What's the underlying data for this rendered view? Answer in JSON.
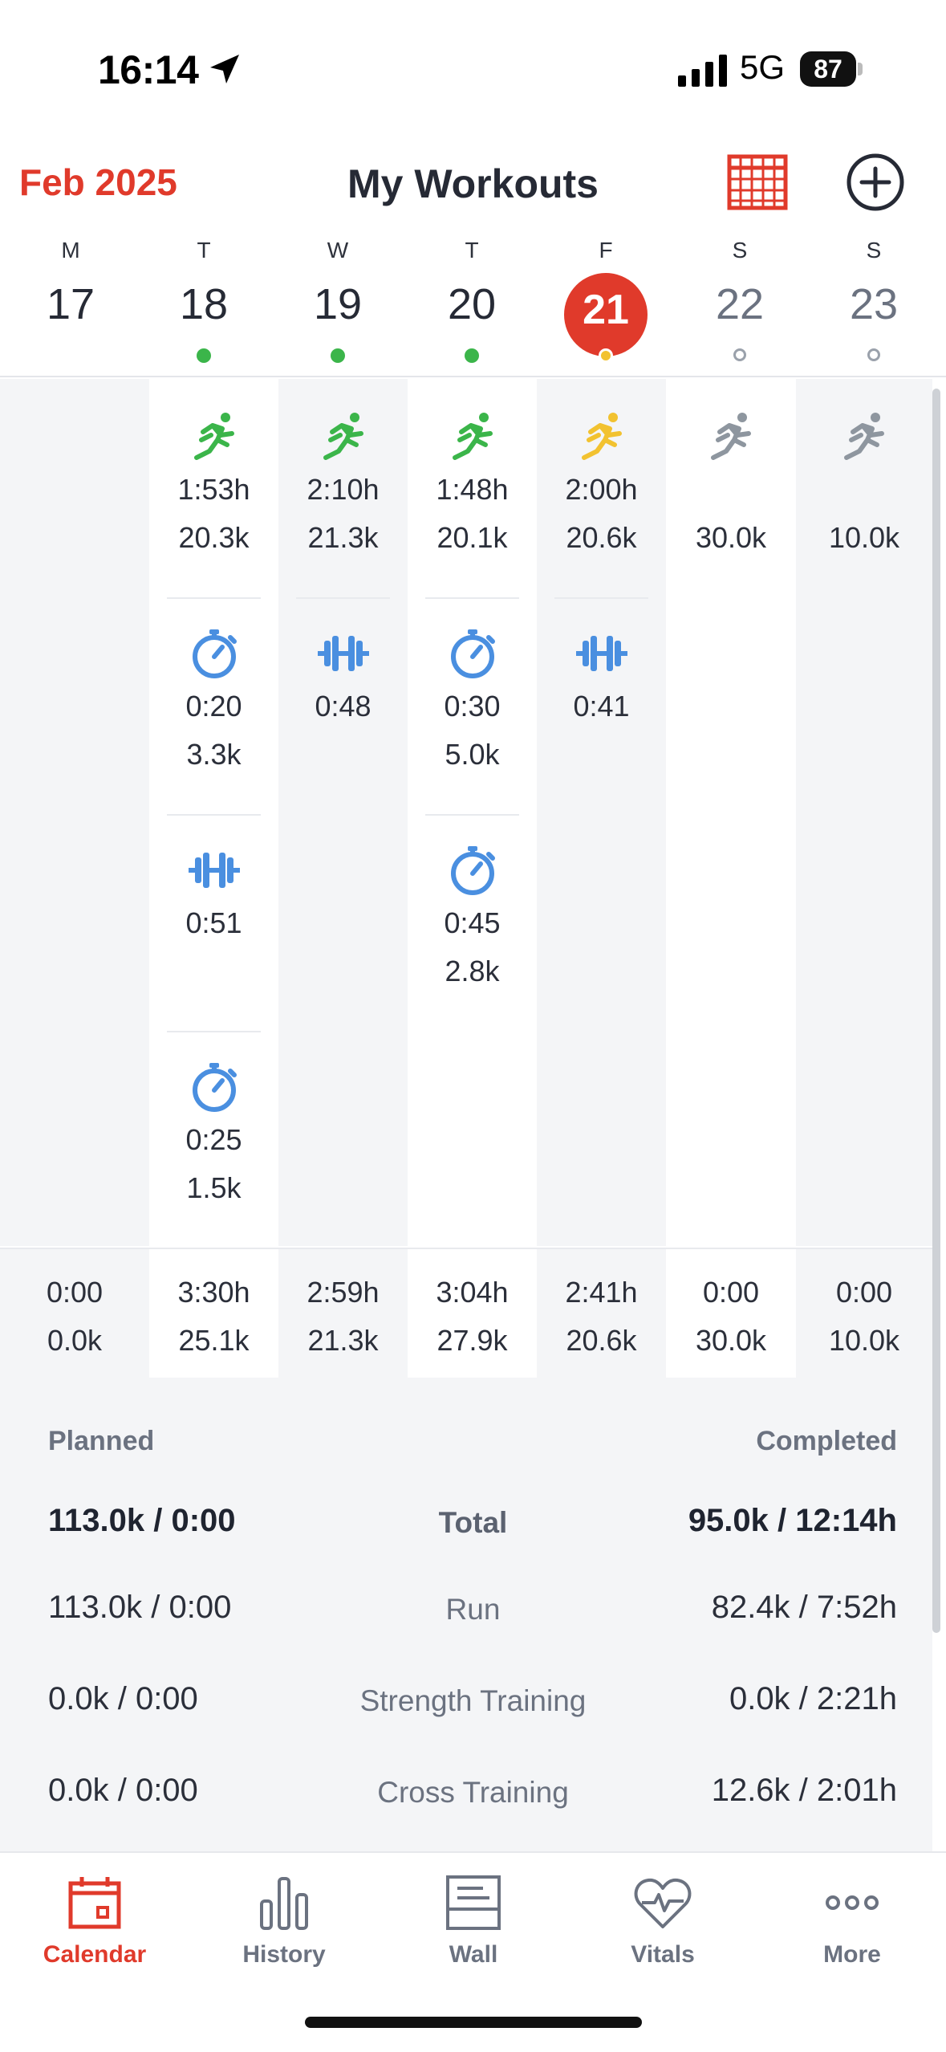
{
  "status_bar": {
    "time": "16:14",
    "network": "5G",
    "battery": "87"
  },
  "header": {
    "month": "Feb 2025",
    "title": "My Workouts"
  },
  "week": [
    {
      "dow": "M",
      "num": "17"
    },
    {
      "dow": "T",
      "num": "18"
    },
    {
      "dow": "W",
      "num": "19"
    },
    {
      "dow": "T",
      "num": "20"
    },
    {
      "dow": "F",
      "num": "21"
    },
    {
      "dow": "S",
      "num": "22"
    },
    {
      "dow": "S",
      "num": "23"
    }
  ],
  "workouts": {
    "tue": [
      {
        "icon": "run-icon",
        "time": "1:53h",
        "dist": "20.3k"
      },
      {
        "icon": "stopwatch-icon",
        "time": "0:20",
        "dist": "3.3k"
      },
      {
        "icon": "dumbbell-icon",
        "time": "0:51"
      },
      {
        "icon": "stopwatch-icon",
        "time": "0:25",
        "dist": "1.5k"
      }
    ],
    "wed": [
      {
        "icon": "run-icon",
        "time": "2:10h",
        "dist": "21.3k"
      },
      {
        "icon": "dumbbell-icon",
        "time": "0:48"
      }
    ],
    "thu": [
      {
        "icon": "run-icon",
        "time": "1:48h",
        "dist": "20.1k"
      },
      {
        "icon": "stopwatch-icon",
        "time": "0:30",
        "dist": "5.0k"
      },
      {
        "icon": "stopwatch-icon",
        "time": "0:45",
        "dist": "2.8k"
      }
    ],
    "fri": [
      {
        "icon": "run-icon",
        "time": "2:00h",
        "dist": "20.6k"
      },
      {
        "icon": "dumbbell-icon",
        "time": "0:41"
      }
    ],
    "sat": [
      {
        "icon": "run-icon",
        "dist": "30.0k"
      }
    ],
    "sun": [
      {
        "icon": "run-icon",
        "dist": "10.0k"
      }
    ]
  },
  "day_totals": [
    {
      "time": "0:00",
      "dist": "0.0k"
    },
    {
      "time": "3:30h",
      "dist": "25.1k"
    },
    {
      "time": "2:59h",
      "dist": "21.3k"
    },
    {
      "time": "3:04h",
      "dist": "27.9k"
    },
    {
      "time": "2:41h",
      "dist": "20.6k"
    },
    {
      "time": "0:00",
      "dist": "30.0k"
    },
    {
      "time": "0:00",
      "dist": "10.0k"
    }
  ],
  "summary": {
    "planned_label": "Planned",
    "completed_label": "Completed",
    "rows": [
      {
        "planned": "113.0k / 0:00",
        "label": "Total",
        "completed": "95.0k / 12:14h"
      },
      {
        "planned": "113.0k / 0:00",
        "label": "Run",
        "completed": "82.4k / 7:52h"
      },
      {
        "planned": "0.0k / 0:00",
        "label": "Strength Training",
        "completed": "0.0k / 2:21h"
      },
      {
        "planned": "0.0k / 0:00",
        "label": "Cross Training",
        "completed": "12.6k / 2:01h"
      }
    ]
  },
  "tabs": [
    {
      "label": "Calendar",
      "icon": "calendar-icon"
    },
    {
      "label": "History",
      "icon": "bar-chart-icon"
    },
    {
      "label": "Wall",
      "icon": "wall-icon"
    },
    {
      "label": "Vitals",
      "icon": "heart-pulse-icon"
    },
    {
      "label": "More",
      "icon": "more-icon"
    }
  ],
  "colors": {
    "accent": "#e03a2b",
    "completed_run": "#3bb54a",
    "today_run": "#f2c230",
    "planned_run": "#8e969f",
    "cross_training": "#4a8fe0"
  }
}
